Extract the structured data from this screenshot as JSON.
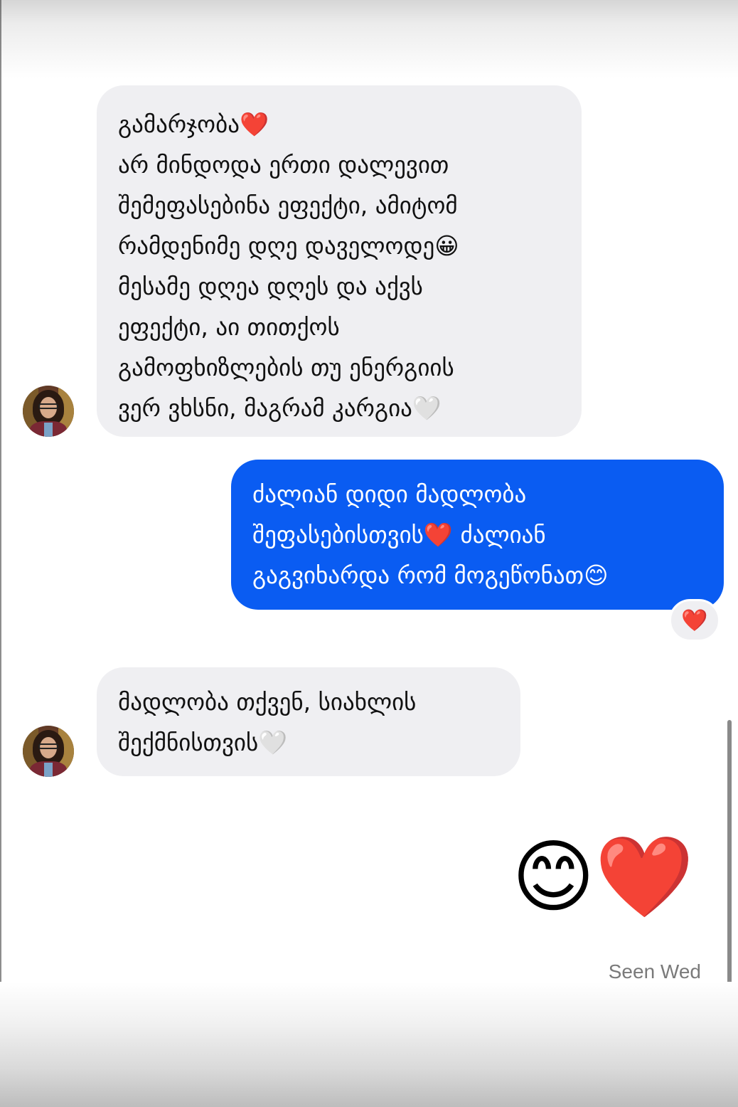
{
  "conversation": {
    "messages": [
      {
        "direction": "incoming",
        "lines": [
          "გამარჯობა❤️",
          "არ მინდოდა ერთი დალევით",
          "შემეფასებინა ეფექტი, ამიტომ",
          "რამდენიმე დღე დაველოდე😀",
          "მესამე დღეა დღეს და აქვს",
          "ეფექტი, აი თითქოს",
          "გამოფხიზლების თუ ენერგიის",
          "ვერ ვხსნი, მაგრამ კარგია🤍"
        ]
      },
      {
        "direction": "outgoing",
        "lines": [
          "ძალიან დიდი მადლობა",
          "შეფასებისთვის❤️ ძალიან",
          "გაგვიხარდა რომ მოგეწონათ😊"
        ],
        "reaction": "❤️"
      },
      {
        "direction": "incoming",
        "lines": [
          "მადლობა თქვენ, სიახლის",
          "შექმნისთვის🤍"
        ]
      },
      {
        "direction": "outgoing",
        "emoji": "😊❤️"
      }
    ],
    "seen_label": "Seen Wed"
  },
  "colors": {
    "incoming_bubble": "#efeff2",
    "outgoing_bubble": "#0a5cf2",
    "seen_text": "#7a7a7a"
  }
}
